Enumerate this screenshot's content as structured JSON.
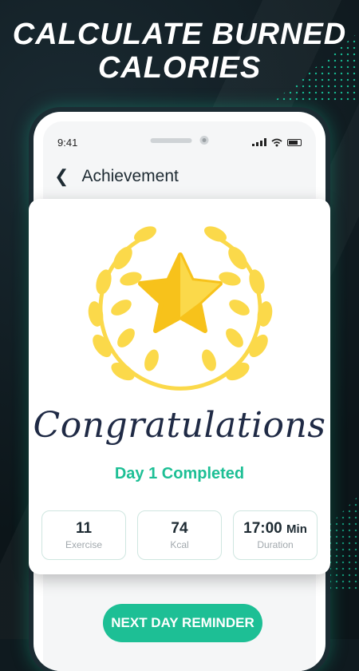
{
  "promo": {
    "headline_line1": "CALCULATE BURNED",
    "headline_line2": "CALORIES"
  },
  "status_bar": {
    "time": "9:41",
    "icons": [
      "signal-icon",
      "wifi-icon",
      "battery-icon"
    ]
  },
  "nav": {
    "back_icon": "chevron-left-icon",
    "title": "Achievement"
  },
  "achievement": {
    "badge_icon": "star-laurel-icon",
    "title": "Congratulations",
    "subtitle": "Day 1 Completed"
  },
  "stats": [
    {
      "value": "11",
      "unit": "",
      "label": "Exercise"
    },
    {
      "value": "74",
      "unit": "",
      "label": "Kcal"
    },
    {
      "value": "17:00",
      "unit": "Min",
      "label": "Duration"
    }
  ],
  "actions": {
    "next_day_reminder": "NEXT DAY REMINDER"
  },
  "colors": {
    "accent": "#1dbf95",
    "gold": "#f7c21b",
    "laurel": "#fbd94a",
    "background": "#0f1a1f",
    "title_text": "#1f2a45"
  }
}
